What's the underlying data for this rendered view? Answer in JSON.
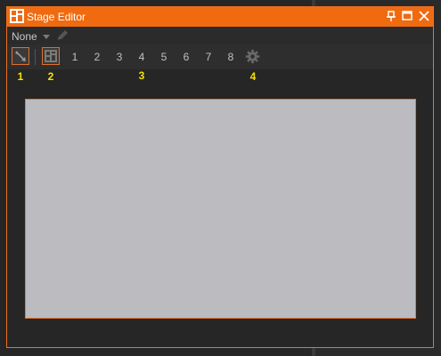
{
  "window": {
    "title": "Stage Editor",
    "controls": {
      "pin": "pin-icon",
      "maximize": "maximize-icon",
      "close": "close-icon"
    }
  },
  "toolbar": {
    "dropdown_value": "None"
  },
  "tools": {
    "stage_numbers": [
      "1",
      "2",
      "3",
      "4",
      "5",
      "6",
      "7",
      "8"
    ]
  },
  "callouts": {
    "one": "1",
    "two": "2",
    "three": "3",
    "four": "4"
  },
  "colors": {
    "accent": "#f06a10",
    "callout": "#f4e000",
    "canvas": "#bcbbbf"
  }
}
